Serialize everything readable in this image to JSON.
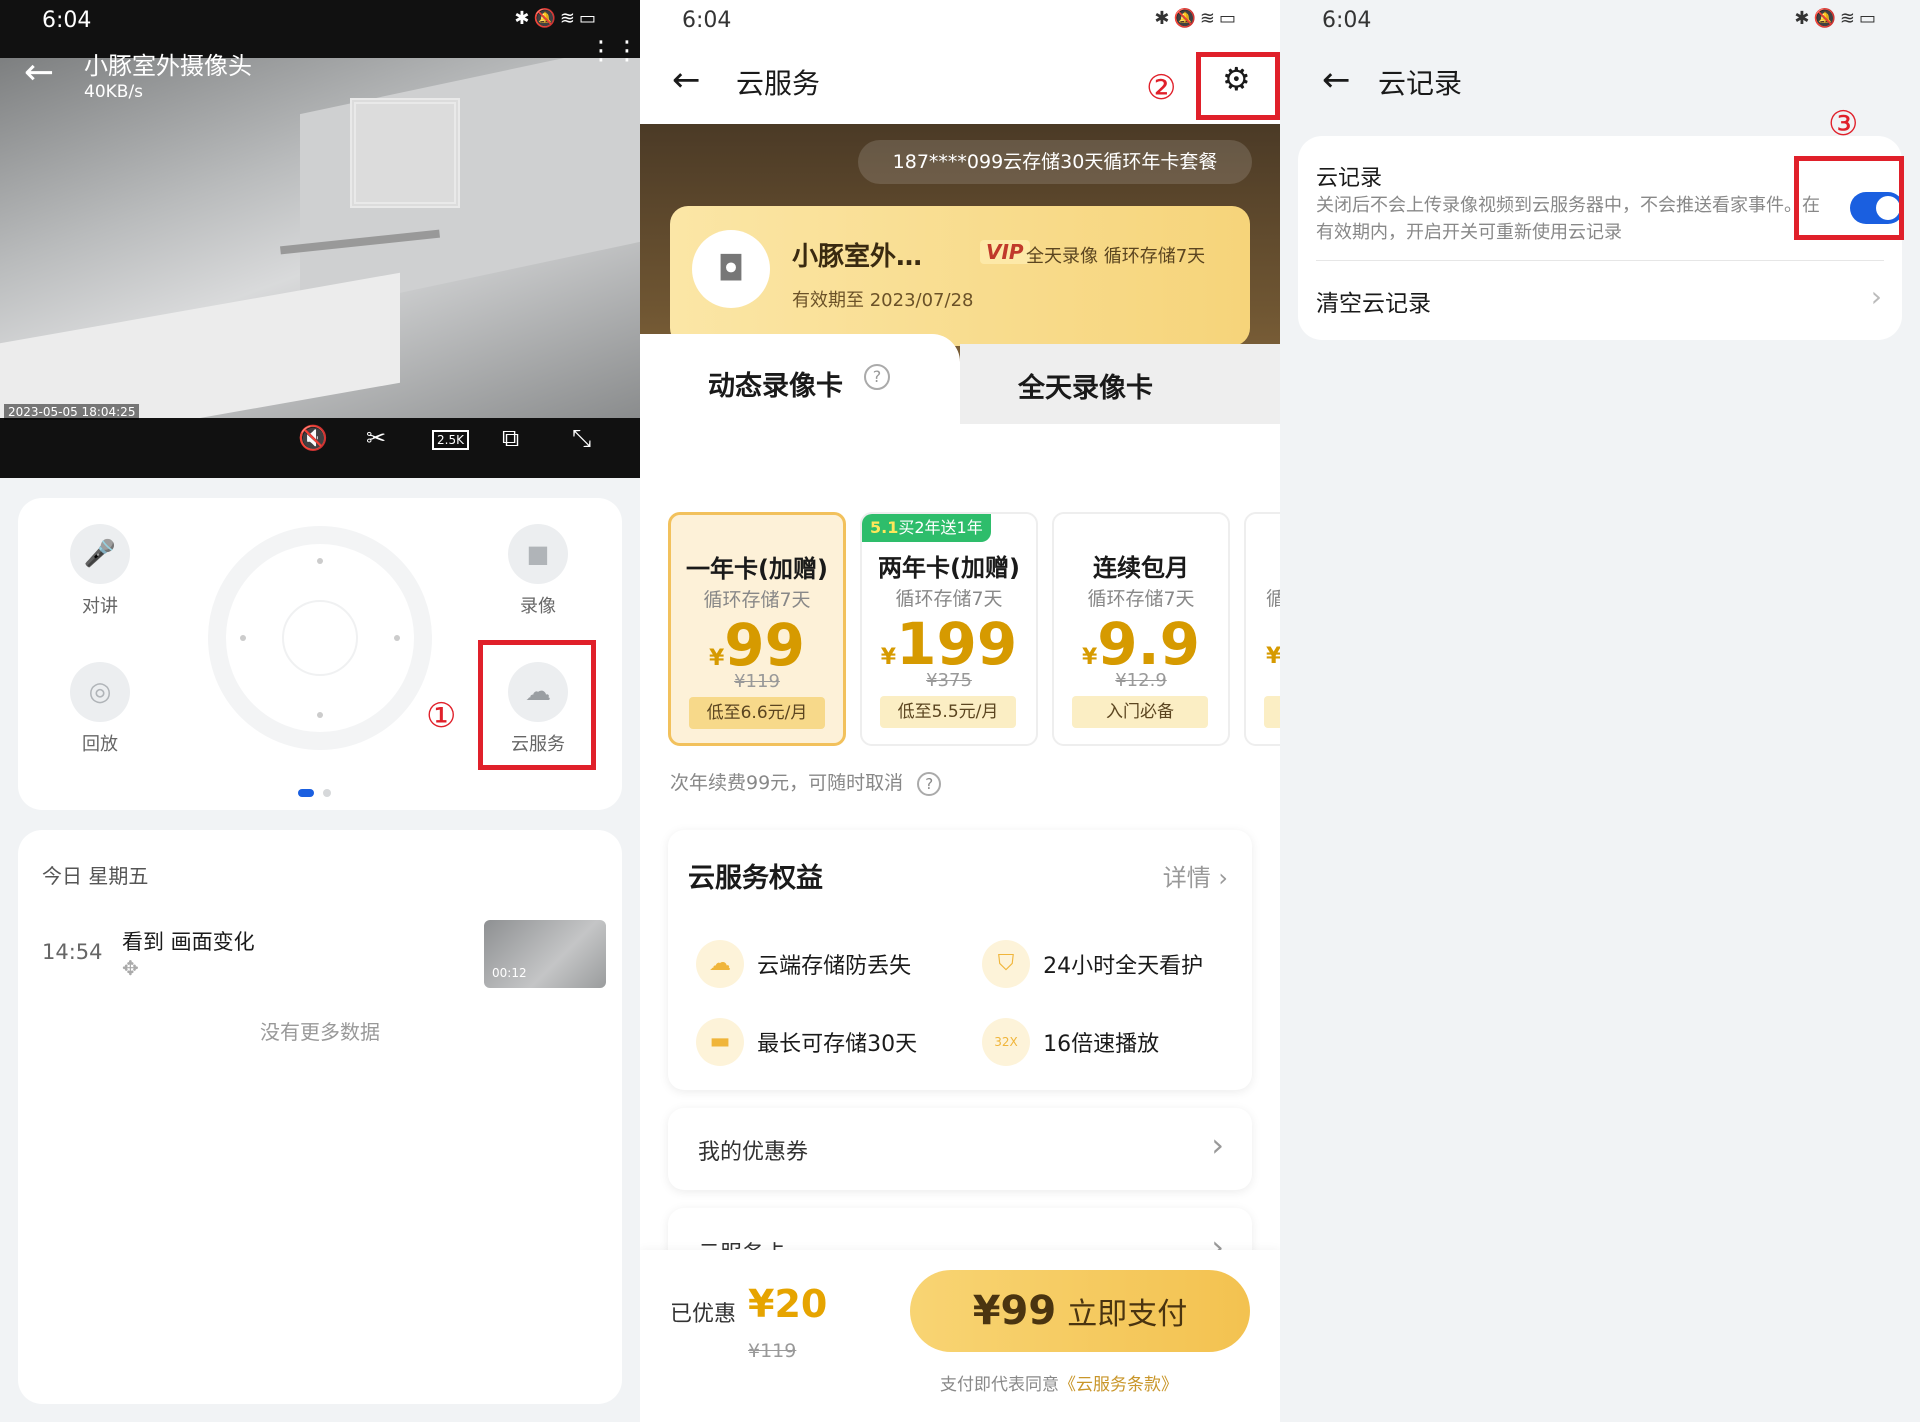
{
  "panel1": {
    "status_time": "6:04",
    "camera_title": "小豚室外摄像头",
    "bitrate": "40KB/s",
    "video_timestamp": "2023-05-05  18:04:25",
    "toolbar": {
      "resolution": "2.5K"
    },
    "controls": {
      "talk_label": "对讲",
      "record_label": "录像",
      "playback_label": "回放",
      "cloud_label": "云服务"
    },
    "annotation": "①",
    "date_header": "今日 星期五",
    "event": {
      "time": "14:54",
      "title": "看到 画面变化",
      "thumb_duration": "00:12"
    },
    "no_more": "没有更多数据"
  },
  "panel2": {
    "status_time": "6:04",
    "title": "云服务",
    "annotation": "②",
    "plan_banner": "187****099云存储30天循环年卡套餐",
    "device": {
      "name": "小豚室外…",
      "vip": "VIP",
      "features": "全天录像  循环存储7天",
      "expiry": "有效期至 2023/07/28"
    },
    "tabs": {
      "motion": "动态录像卡",
      "full": "全天录像卡"
    },
    "cards": [
      {
        "title": "一年卡(加赠)",
        "sub": "循环存储7天",
        "currency": "¥",
        "price": "99",
        "orig": "¥119",
        "badge": "低至6.6元/月",
        "tag": ""
      },
      {
        "title": "两年卡(加赠)",
        "sub": "循环存储7天",
        "currency": "¥",
        "price": "199",
        "orig": "¥375",
        "badge": "低至5.5元/月",
        "tag_strong": "5.1",
        "tag": "买2年送1年"
      },
      {
        "title": "连续包月",
        "sub": "循环存储7天",
        "currency": "¥",
        "price": "9.9",
        "orig": "¥12.9",
        "badge": "入门必备",
        "tag": ""
      }
    ],
    "card4_partial": {
      "sub": "循",
      "currency": "¥"
    },
    "renew_note": "次年续费99元，可随时取消",
    "benefits": {
      "title": "云服务权益",
      "details": "详情",
      "items": [
        "云端存储防丢失",
        "24小时全天看护",
        "最长可存储30天",
        "16倍速播放"
      ],
      "speed_icon_text": "32X"
    },
    "coupons_label": "我的优惠券",
    "cloud_card_label": "云服务卡",
    "footer": {
      "saved_label": "已优惠",
      "saved_amount": "¥20",
      "orig_price": "¥119",
      "pay_price": "¥99",
      "pay_label": "立即支付",
      "terms_prefix": "支付即代表同意",
      "terms_link": "《云服务条款》"
    }
  },
  "panel3": {
    "status_time": "6:04",
    "title": "云记录",
    "annotation": "③",
    "setting_title": "云记录",
    "setting_desc": "关闭后不会上传录像视频到云服务器中，不会推送看家事件。在有效期内，开启开关可重新使用云记录",
    "toggle_on": true,
    "clear_label": "清空云记录"
  },
  "colors": {
    "annotation_red": "#e0202a",
    "gold": "#e8b84a",
    "price_gold": "#d69a00",
    "toggle_blue": "#1a5fe0",
    "carousel_dot": "#1a5fe0"
  },
  "icons": [
    "back-arrow-icon",
    "more-icon",
    "mute-icon",
    "screenshot-icon",
    "multi-screen-icon",
    "fullscreen-icon",
    "mic-icon",
    "video-camera-icon",
    "playback-icon",
    "cloud-icon",
    "move-icon",
    "gear-icon",
    "help-icon",
    "chevron-right-icon",
    "bluetooth-icon",
    "wifi-icon",
    "battery-icon"
  ]
}
